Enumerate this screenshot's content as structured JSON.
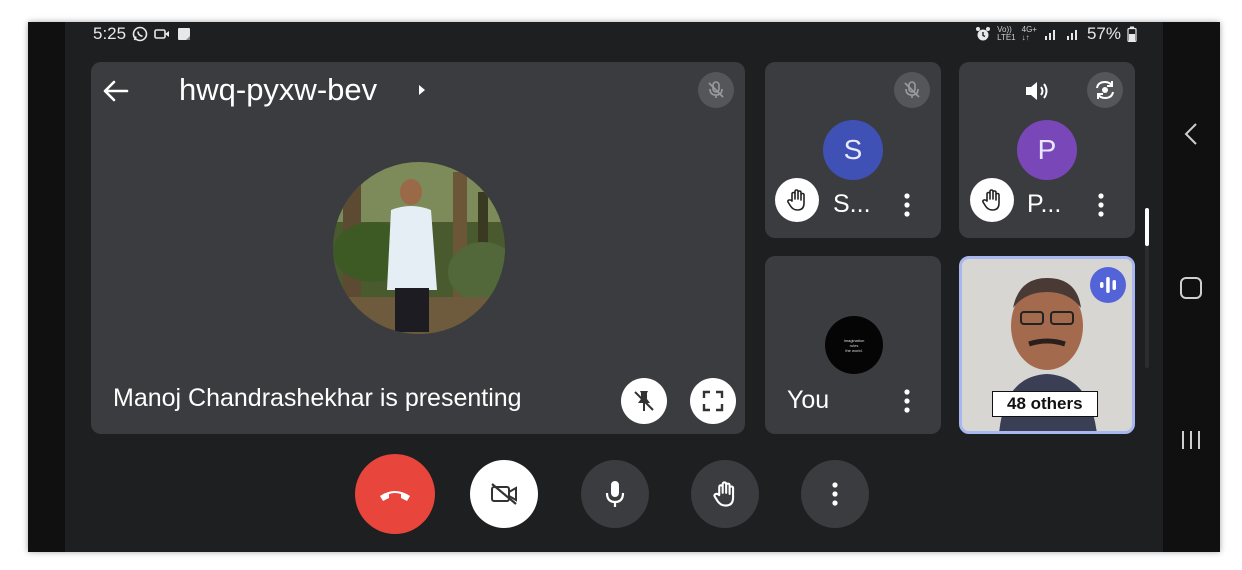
{
  "status_bar": {
    "time": "5:25",
    "battery": "57%",
    "network_top": "Vo))",
    "network_bottom": "LTE1",
    "data_top": "4G+",
    "data_bottom": "↓↑",
    "icons": [
      "whatsapp-icon",
      "video-icon",
      "notification-icon",
      "alarm-icon",
      "signal-icon",
      "battery-icon"
    ]
  },
  "meeting": {
    "code": "hwq-pyxw-bev",
    "presenting_text": "Manoj Chandrashekhar is presenting"
  },
  "participants": [
    {
      "initial": "S",
      "name": "S...",
      "hand_raised": true,
      "avatar_color": "#3f51b5"
    },
    {
      "initial": "P",
      "name": "P...",
      "hand_raised": true,
      "avatar_color": "#7a47b8"
    },
    {
      "name": "You",
      "avatar_text": [
        "Imagination",
        "rules",
        "the world."
      ]
    },
    {
      "label": "48 others",
      "speaking": true
    }
  ],
  "controls": {
    "end_call_color": "#e8453c",
    "labels": [
      "end-call",
      "camera-off",
      "microphone",
      "raise-hand",
      "more-options"
    ]
  },
  "colors": {
    "tile_bg": "#3b3c3f",
    "screen_bg": "#1e1f21",
    "speaking_accent": "#5364d8",
    "highlight_border": "#a9b7f0"
  }
}
